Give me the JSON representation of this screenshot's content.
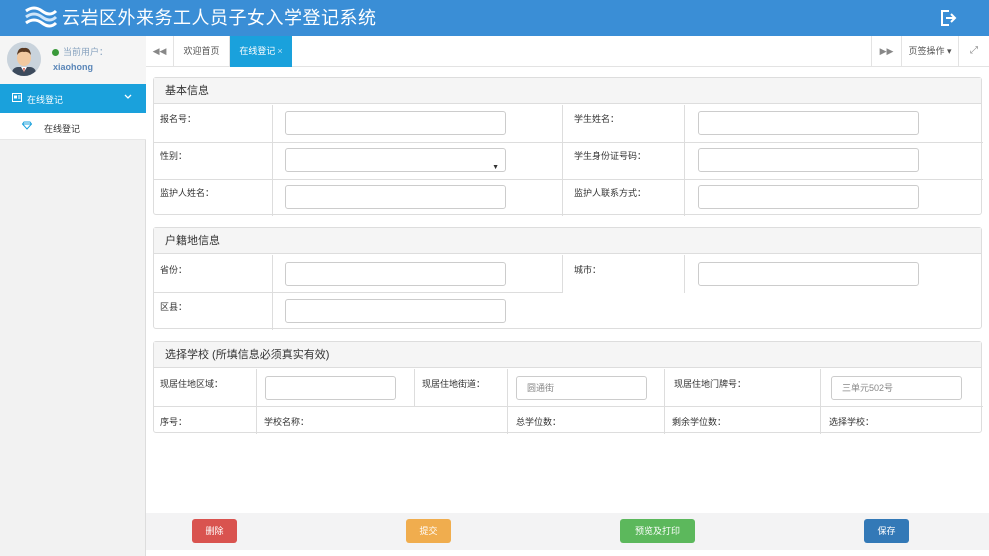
{
  "header": {
    "title": "云岩区外来务工人员子女入学登记系统"
  },
  "user": {
    "label": "当前用户：",
    "name": "xiaohong"
  },
  "sidebar": {
    "items": [
      {
        "label": "在线登记",
        "children": [
          {
            "label": "在线登记"
          }
        ]
      }
    ]
  },
  "tabs": {
    "items": [
      {
        "label": "欢迎首页"
      },
      {
        "label": "在线登记",
        "close": "×"
      }
    ],
    "ops_label": "页签操作"
  },
  "basic": {
    "title": "基本信息",
    "reg_no": "报名号：",
    "student_name": "学生姓名：",
    "gender": "性别：",
    "student_id": "学生身份证号码：",
    "guardian_name": "监护人姓名：",
    "guardian_phone": "监护人联系方式："
  },
  "huji": {
    "title": "户籍地信息",
    "province": "省份：",
    "city": "城市：",
    "county": "区县："
  },
  "school": {
    "title": "选择学校 (所填信息必须真实有效)",
    "area": "现居住地区域：",
    "street": "现居住地街道：",
    "street_placeholder": "圆通街",
    "door": "现居住地门牌号：",
    "door_placeholder": "三单元502号",
    "columns": [
      "序号：",
      "学校名称：",
      "总学位数：",
      "剩余学位数：",
      "选择学校："
    ]
  },
  "buttons": {
    "delete": "删除",
    "submit": "提交",
    "preview": "预览及打印",
    "save": "保存"
  },
  "colors": {
    "header": "#3a8ed6",
    "accent": "#1aa1dc",
    "danger": "#d9534f",
    "warning": "#f0ad4e",
    "success": "#5cb85c",
    "primary": "#3379b7"
  }
}
